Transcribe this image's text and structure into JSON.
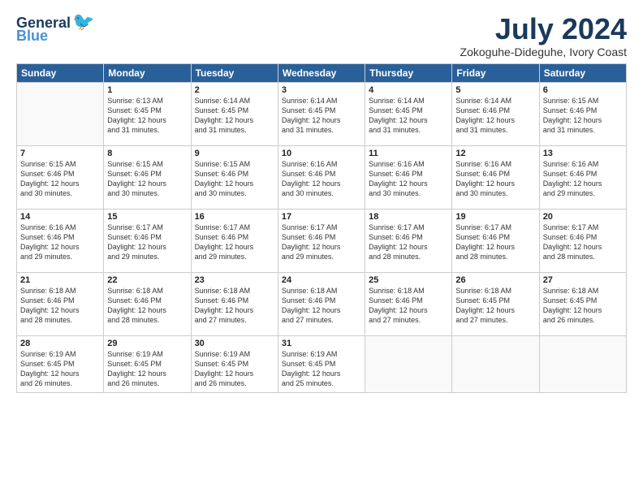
{
  "logo": {
    "line1": "General",
    "line2": "Blue"
  },
  "title": "July 2024",
  "subtitle": "Zokoguhe-Dideguhe, Ivory Coast",
  "days": [
    "Sunday",
    "Monday",
    "Tuesday",
    "Wednesday",
    "Thursday",
    "Friday",
    "Saturday"
  ],
  "weeks": [
    [
      {
        "num": "",
        "info": ""
      },
      {
        "num": "1",
        "info": "Sunrise: 6:13 AM\nSunset: 6:45 PM\nDaylight: 12 hours\nand 31 minutes."
      },
      {
        "num": "2",
        "info": "Sunrise: 6:14 AM\nSunset: 6:45 PM\nDaylight: 12 hours\nand 31 minutes."
      },
      {
        "num": "3",
        "info": "Sunrise: 6:14 AM\nSunset: 6:45 PM\nDaylight: 12 hours\nand 31 minutes."
      },
      {
        "num": "4",
        "info": "Sunrise: 6:14 AM\nSunset: 6:45 PM\nDaylight: 12 hours\nand 31 minutes."
      },
      {
        "num": "5",
        "info": "Sunrise: 6:14 AM\nSunset: 6:46 PM\nDaylight: 12 hours\nand 31 minutes."
      },
      {
        "num": "6",
        "info": "Sunrise: 6:15 AM\nSunset: 6:46 PM\nDaylight: 12 hours\nand 31 minutes."
      }
    ],
    [
      {
        "num": "7",
        "info": "Sunrise: 6:15 AM\nSunset: 6:46 PM\nDaylight: 12 hours\nand 30 minutes."
      },
      {
        "num": "8",
        "info": "Sunrise: 6:15 AM\nSunset: 6:46 PM\nDaylight: 12 hours\nand 30 minutes."
      },
      {
        "num": "9",
        "info": "Sunrise: 6:15 AM\nSunset: 6:46 PM\nDaylight: 12 hours\nand 30 minutes."
      },
      {
        "num": "10",
        "info": "Sunrise: 6:16 AM\nSunset: 6:46 PM\nDaylight: 12 hours\nand 30 minutes."
      },
      {
        "num": "11",
        "info": "Sunrise: 6:16 AM\nSunset: 6:46 PM\nDaylight: 12 hours\nand 30 minutes."
      },
      {
        "num": "12",
        "info": "Sunrise: 6:16 AM\nSunset: 6:46 PM\nDaylight: 12 hours\nand 30 minutes."
      },
      {
        "num": "13",
        "info": "Sunrise: 6:16 AM\nSunset: 6:46 PM\nDaylight: 12 hours\nand 29 minutes."
      }
    ],
    [
      {
        "num": "14",
        "info": "Sunrise: 6:16 AM\nSunset: 6:46 PM\nDaylight: 12 hours\nand 29 minutes."
      },
      {
        "num": "15",
        "info": "Sunrise: 6:17 AM\nSunset: 6:46 PM\nDaylight: 12 hours\nand 29 minutes."
      },
      {
        "num": "16",
        "info": "Sunrise: 6:17 AM\nSunset: 6:46 PM\nDaylight: 12 hours\nand 29 minutes."
      },
      {
        "num": "17",
        "info": "Sunrise: 6:17 AM\nSunset: 6:46 PM\nDaylight: 12 hours\nand 29 minutes."
      },
      {
        "num": "18",
        "info": "Sunrise: 6:17 AM\nSunset: 6:46 PM\nDaylight: 12 hours\nand 28 minutes."
      },
      {
        "num": "19",
        "info": "Sunrise: 6:17 AM\nSunset: 6:46 PM\nDaylight: 12 hours\nand 28 minutes."
      },
      {
        "num": "20",
        "info": "Sunrise: 6:17 AM\nSunset: 6:46 PM\nDaylight: 12 hours\nand 28 minutes."
      }
    ],
    [
      {
        "num": "21",
        "info": "Sunrise: 6:18 AM\nSunset: 6:46 PM\nDaylight: 12 hours\nand 28 minutes."
      },
      {
        "num": "22",
        "info": "Sunrise: 6:18 AM\nSunset: 6:46 PM\nDaylight: 12 hours\nand 28 minutes."
      },
      {
        "num": "23",
        "info": "Sunrise: 6:18 AM\nSunset: 6:46 PM\nDaylight: 12 hours\nand 27 minutes."
      },
      {
        "num": "24",
        "info": "Sunrise: 6:18 AM\nSunset: 6:46 PM\nDaylight: 12 hours\nand 27 minutes."
      },
      {
        "num": "25",
        "info": "Sunrise: 6:18 AM\nSunset: 6:46 PM\nDaylight: 12 hours\nand 27 minutes."
      },
      {
        "num": "26",
        "info": "Sunrise: 6:18 AM\nSunset: 6:45 PM\nDaylight: 12 hours\nand 27 minutes."
      },
      {
        "num": "27",
        "info": "Sunrise: 6:18 AM\nSunset: 6:45 PM\nDaylight: 12 hours\nand 26 minutes."
      }
    ],
    [
      {
        "num": "28",
        "info": "Sunrise: 6:19 AM\nSunset: 6:45 PM\nDaylight: 12 hours\nand 26 minutes."
      },
      {
        "num": "29",
        "info": "Sunrise: 6:19 AM\nSunset: 6:45 PM\nDaylight: 12 hours\nand 26 minutes."
      },
      {
        "num": "30",
        "info": "Sunrise: 6:19 AM\nSunset: 6:45 PM\nDaylight: 12 hours\nand 26 minutes."
      },
      {
        "num": "31",
        "info": "Sunrise: 6:19 AM\nSunset: 6:45 PM\nDaylight: 12 hours\nand 25 minutes."
      },
      {
        "num": "",
        "info": ""
      },
      {
        "num": "",
        "info": ""
      },
      {
        "num": "",
        "info": ""
      }
    ]
  ]
}
